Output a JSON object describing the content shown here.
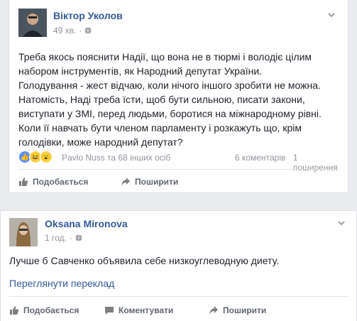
{
  "post1": {
    "author": "Віктор Уколов",
    "time": "49 хв.",
    "paragraphs": [
      "Треба якось пояснити Надії, що вона не в тюрмі і володіє цілим набором інструментів, як Народний депутат України.",
      "Голодування - жест відчаю, коли нічого іншого зробити не можна.",
      "Натомість, Наді треба їсти, щоб бути сильною, писати закони, виступати у ЗМІ, перед людьми, боротися на міжнародному рівні.",
      "Коли її навчать бути членом парламенту і розкажуть що, крім голодівки, може народний депутат?"
    ],
    "reactors": "Pavlo Nuss та 68 інших осіб",
    "comments_count": "6 коментарів",
    "shares_count": "1 поширення",
    "like_label": "Подобається",
    "share_label": "Поширити"
  },
  "post2": {
    "author": "Oksana Mironova",
    "time": "1 год.",
    "text": "Лучше б Савченко объявила себе низкоуглеводную диету.",
    "translate_link": "Переглянути переклад",
    "like_label": "Подобається",
    "comment_label": "Коментувати",
    "share_label": "Поширити"
  },
  "colors": {
    "link": "#365899",
    "muted": "#90949c",
    "like": "#5890ff"
  }
}
